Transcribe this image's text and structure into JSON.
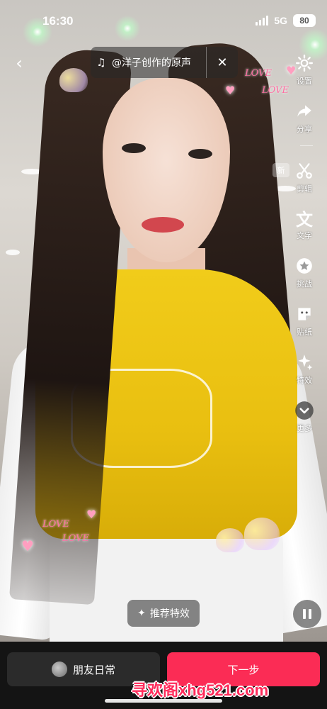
{
  "status_bar": {
    "time": "16:30",
    "network": "5G",
    "battery": "80"
  },
  "music": {
    "title": "@洋子创作的原声",
    "note_icon": "music-note-icon",
    "close_icon": "close-icon"
  },
  "overlay": {
    "love_text": "LOVE",
    "new_badge": "新"
  },
  "toolbar": {
    "items": [
      {
        "label": "设置",
        "icon": "settings-icon"
      },
      {
        "label": "分享",
        "icon": "share-icon"
      },
      {
        "label": "剪辑",
        "icon": "scissors-icon"
      },
      {
        "label": "文字",
        "icon": "text-icon"
      },
      {
        "label": "挑战",
        "icon": "challenge-icon"
      },
      {
        "label": "贴纸",
        "icon": "sticker-icon"
      },
      {
        "label": "特效",
        "icon": "effects-icon"
      },
      {
        "label": "更多",
        "icon": "more-chevron-icon"
      }
    ]
  },
  "effects_button": {
    "label": "推荐特效"
  },
  "bottom": {
    "friends_label": "朋友日常",
    "next_label": "下一步"
  },
  "watermark": "寻欢阁xhg521.com"
}
